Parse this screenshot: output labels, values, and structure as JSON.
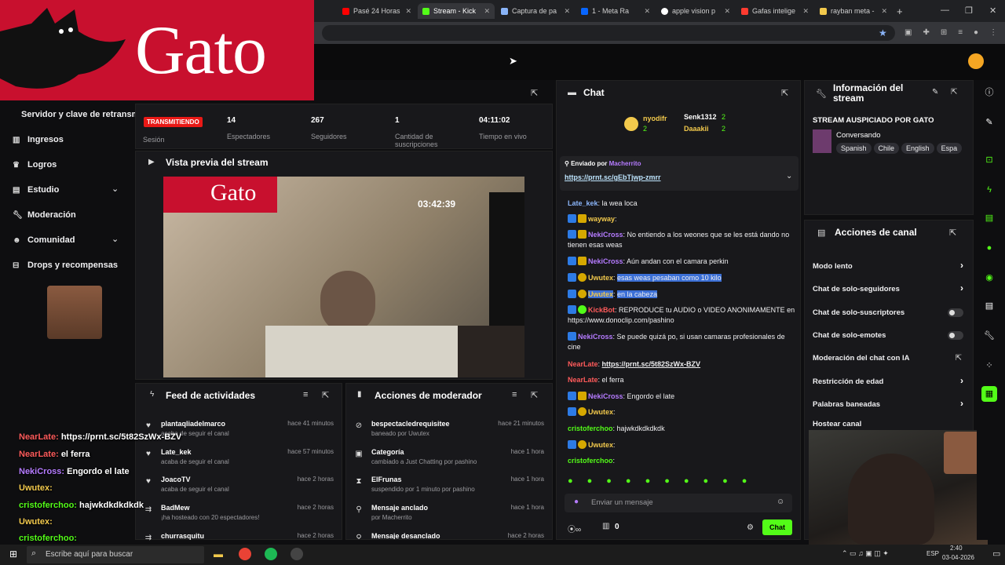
{
  "browser": {
    "tabs": [
      {
        "label": "Pasé 24 Horas",
        "color": "#ff0000"
      },
      {
        "label": "Stream - Kick",
        "color": "#53fc18"
      },
      {
        "label": "Captura de pa",
        "color": "#8ab4f8"
      },
      {
        "label": "1 - Meta Ra",
        "color": "#0866ff"
      },
      {
        "label": "apple vision p",
        "color": "#ffffff"
      },
      {
        "label": "Gafas intelige",
        "color": "#ff3b30"
      },
      {
        "label": "rayban meta -",
        "color": "#f2c94c"
      }
    ],
    "new_tab": "+"
  },
  "overlay": {
    "brand": "Gato"
  },
  "sidebar": {
    "header": "Servidor y clave de retransmisión",
    "items": [
      {
        "label": "Ingresos",
        "icon": "chart-icon"
      },
      {
        "label": "Logros",
        "icon": "trophy-icon"
      },
      {
        "label": "Estudio",
        "icon": "studio-icon"
      },
      {
        "label": "Moderación",
        "icon": "wrench-icon"
      },
      {
        "label": "Comunidad",
        "icon": "community-icon"
      },
      {
        "label": "Drops y recompensas",
        "icon": "gift-icon"
      }
    ]
  },
  "stats": {
    "live_badge": "TRANSMITIENDO",
    "session": "Sesión",
    "viewers": "14",
    "viewers_label": "Espectadores",
    "followers": "267",
    "followers_label": "Seguidores",
    "subs": "1",
    "subs_label": "Cantidad de suscripciones",
    "time": "04:11:02",
    "time_label": "Tiempo en vivo"
  },
  "preview": {
    "title": "Vista previa del stream",
    "timer": "03:42:39"
  },
  "feed": {
    "title": "Feed de actividades",
    "rows": [
      {
        "name": "plantaqliadelmarco",
        "sub": "acaba de seguir el canal",
        "time": "hace 41 minutos"
      },
      {
        "name": "Late_kek",
        "sub": "acaba de seguir el canal",
        "time": "hace 57 minutos"
      },
      {
        "name": "JoacoTV",
        "sub": "acaba de seguir el canal",
        "time": "hace 2 horas"
      },
      {
        "name": "BadMew",
        "sub": "¡ha hosteado con 20 espectadores!",
        "time": "hace 2 horas"
      },
      {
        "name": "churrasquitu",
        "sub": "",
        "time": "hace 2 horas"
      }
    ]
  },
  "modactions": {
    "title": "Acciones de moderador",
    "rows": [
      {
        "name": "bespectacledrequisitee",
        "sub": "baneado por Uwutex",
        "time": "hace 21 minutos"
      },
      {
        "name": "Categoría",
        "sub": "cambiado a Just Chatting por pashino",
        "time": "hace 1 hora"
      },
      {
        "name": "ElFrunas",
        "sub": "suspendido por 1 minuto por pashino",
        "time": "hace 1 hora"
      },
      {
        "name": "Mensaje anclado",
        "sub": "por Macherrito",
        "time": "hace 1 hora"
      },
      {
        "name": "Mensaje desanclado",
        "sub": "",
        "time": "hace 2 horas"
      }
    ]
  },
  "chat": {
    "title": "Chat",
    "top": [
      {
        "name": "nyodifr",
        "count": "2"
      },
      {
        "name": "Senk1312",
        "count": "2"
      },
      {
        "name": "Daaakii",
        "count": "2"
      }
    ],
    "pinned_by_label": "Enviado por",
    "pinned_by": "Macherrito",
    "pinned_link": "https://prnt.sc/gEbTjwp-zmrr",
    "messages": [
      {
        "user": "Late_kek",
        "color": "#8ab4f8",
        "text": "la wea loca"
      },
      {
        "user": "wayway",
        "color": "#f2c94c",
        "text": ""
      },
      {
        "user": "NekiCross",
        "color": "#b57bff",
        "text": "No entiendo a los weones que se les está dando no tienen esas weas"
      },
      {
        "user": "NekiCross",
        "color": "#b57bff",
        "text": "Aún andan con el camara perkin"
      },
      {
        "user": "Uwutex",
        "color": "#f2c94c",
        "text": "esas weas pesaban como 10 kilo"
      },
      {
        "user": "Uwutex",
        "color": "#f2c94c",
        "text": "en la cabeza"
      },
      {
        "user": "KickBot",
        "color": "#53fc18",
        "text": "REPRODUCE tu AUDIO o VIDEO ANONIMAMENTE en https://www.donoclip.com/pashino"
      },
      {
        "user": "NekiCross",
        "color": "#b57bff",
        "text": "Se puede quizá po, si usan camaras profesionales de cine"
      },
      {
        "user": "NearLate",
        "color": "#ff5b5b",
        "text": "https://prnt.sc/5t82SzWx-BZV"
      },
      {
        "user": "NearLate",
        "color": "#ff5b5b",
        "text": "el ferra"
      },
      {
        "user": "NekiCross",
        "color": "#b57bff",
        "text": "Engordo el late"
      },
      {
        "user": "Uwutex",
        "color": "#f2c94c",
        "text": ""
      },
      {
        "user": "cristoferchoo",
        "color": "#53fc18",
        "text": "hajwkdkdkdkdk"
      },
      {
        "user": "Uwutex",
        "color": "#f2c94c",
        "text": ""
      },
      {
        "user": "cristoferchoo",
        "color": "#53fc18",
        "text": ""
      }
    ],
    "input_placeholder": "Enviar un mensaje",
    "points": "0",
    "send": "Chat"
  },
  "info": {
    "title": "Información del stream",
    "stream_title": "STREAM AUSPICIADO POR GATO",
    "category": "Conversando",
    "tags": [
      "Spanish",
      "Chile",
      "English",
      "Espa"
    ]
  },
  "channel_actions": {
    "title": "Acciones de canal",
    "items": [
      {
        "label": "Modo lento",
        "kind": "chevron"
      },
      {
        "label": "Chat de solo-seguidores",
        "kind": "chevron"
      },
      {
        "label": "Chat de solo-suscriptores",
        "kind": "toggle"
      },
      {
        "label": "Chat de solo-emotes",
        "kind": "toggle"
      },
      {
        "label": "Moderación del chat con IA",
        "kind": "external"
      },
      {
        "label": "Restricción de edad",
        "kind": "chevron"
      },
      {
        "label": "Palabras baneadas",
        "kind": "chevron"
      },
      {
        "label": "Hostear canal",
        "kind": "none"
      }
    ]
  },
  "overlay_chat": [
    {
      "user": "NearLate:",
      "text": "https://prnt.sc/5t82SzWx-BZV",
      "color": "#ff5b5b"
    },
    {
      "user": "NearLate:",
      "text": "el ferra",
      "color": "#ff5b5b"
    },
    {
      "user": "NekiCross:",
      "text": "Engordo el late",
      "color": "#b57bff"
    },
    {
      "user": "Uwutex:",
      "text": "",
      "color": "#f2c94c"
    },
    {
      "user": "cristoferchoo:",
      "text": "hajwkdkdkdkdk",
      "color": "#53fc18"
    },
    {
      "user": "Uwutex:",
      "text": "",
      "color": "#f2c94c"
    },
    {
      "user": "cristoferchoo:",
      "text": "",
      "color": "#53fc18"
    }
  ],
  "taskbar": {
    "search": "Escribe aquí para buscar",
    "time": "2:40",
    "date": "03-04-2026",
    "lang": "ESP"
  },
  "colors": {
    "kick_green": "#53fc18",
    "gato_red": "#c8102e",
    "bg": "#0e0e10",
    "panel": "#18181b"
  }
}
